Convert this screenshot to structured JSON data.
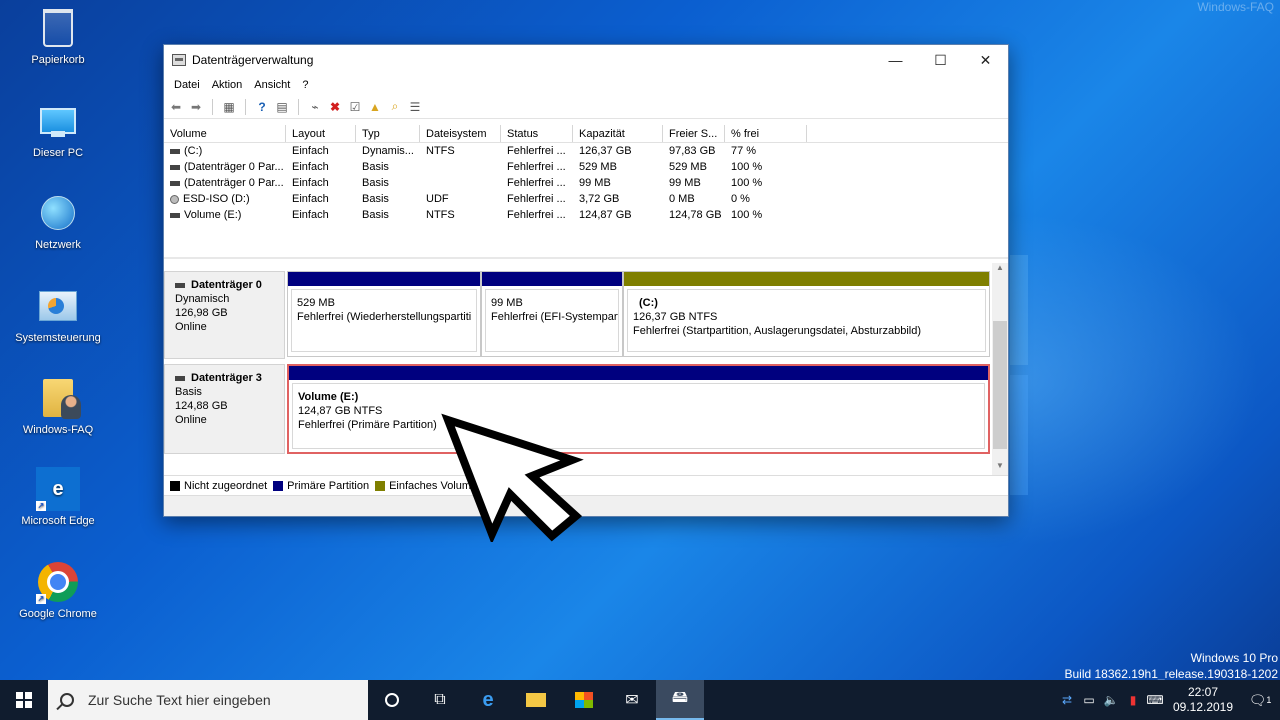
{
  "watermark": "Windows-FAQ",
  "desktop_icons": [
    {
      "label": "Papierkorb"
    },
    {
      "label": "Dieser PC"
    },
    {
      "label": "Netzwerk"
    },
    {
      "label": "Systemsteuerung"
    },
    {
      "label": "Windows-FAQ"
    },
    {
      "label": "Microsoft Edge"
    },
    {
      "label": "Google Chrome"
    }
  ],
  "window": {
    "title": "Datenträgerverwaltung",
    "menu": [
      "Datei",
      "Aktion",
      "Ansicht",
      "?"
    ],
    "columns": [
      "Volume",
      "Layout",
      "Typ",
      "Dateisystem",
      "Status",
      "Kapazität",
      "Freier S...",
      "% frei"
    ],
    "volumes": [
      {
        "volume": "(C:)",
        "layout": "Einfach",
        "typ": "Dynamis...",
        "fs": "NTFS",
        "status": "Fehlerfrei ...",
        "kap": "126,37 GB",
        "frei": "97,83 GB",
        "pct": "77 %"
      },
      {
        "volume": "(Datenträger 0 Par...",
        "layout": "Einfach",
        "typ": "Basis",
        "fs": "",
        "status": "Fehlerfrei ...",
        "kap": "529 MB",
        "frei": "529 MB",
        "pct": "100 %"
      },
      {
        "volume": "(Datenträger 0 Par...",
        "layout": "Einfach",
        "typ": "Basis",
        "fs": "",
        "status": "Fehlerfrei ...",
        "kap": "99 MB",
        "frei": "99 MB",
        "pct": "100 %"
      },
      {
        "volume": "ESD-ISO (D:)",
        "layout": "Einfach",
        "typ": "Basis",
        "fs": "UDF",
        "status": "Fehlerfrei ...",
        "kap": "3,72 GB",
        "frei": "0 MB",
        "pct": "0 %"
      },
      {
        "volume": "Volume (E:)",
        "layout": "Einfach",
        "typ": "Basis",
        "fs": "NTFS",
        "status": "Fehlerfrei ...",
        "kap": "124,87 GB",
        "frei": "124,78 GB",
        "pct": "100 %"
      }
    ],
    "disk0": {
      "name": "Datenträger 0",
      "type": "Dynamisch",
      "size": "126,98 GB",
      "state": "Online",
      "p1": {
        "size": "529 MB",
        "status": "Fehlerfrei (Wiederherstellungspartiti"
      },
      "p2": {
        "size": "99 MB",
        "status": "Fehlerfrei (EFI-Systempart"
      },
      "p3": {
        "name": "(C:)",
        "size": "126,37 GB NTFS",
        "status": "Fehlerfrei (Startpartition, Auslagerungsdatei, Absturzabbild)"
      }
    },
    "disk3": {
      "name": "Datenträger 3",
      "type": "Basis",
      "size": "124,88 GB",
      "state": "Online",
      "p1": {
        "name": "Volume  (E:)",
        "size": "124,87 GB NTFS",
        "status": "Fehlerfrei (Primäre Partition)"
      }
    },
    "legend": [
      "Nicht zugeordnet",
      "Primäre Partition",
      "Einfaches Volume"
    ],
    "colors": {
      "unallocated": "#000000",
      "primary": "#00007f",
      "simple": "#7f7f00",
      "selection": "#e06262"
    }
  },
  "taskbar": {
    "search_placeholder": "Zur Suche Text hier eingeben",
    "time": "22:07",
    "date": "09.12.2019",
    "notification_count": "1"
  },
  "os_info": {
    "edition": "Windows 10 Pro",
    "build": "Build 18362.19h1_release.190318-1202"
  }
}
